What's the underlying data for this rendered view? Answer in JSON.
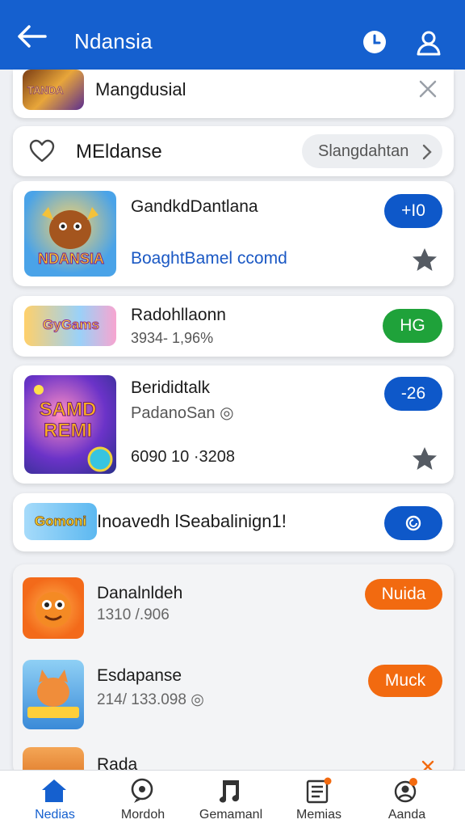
{
  "app": {
    "title": "Ndansia"
  },
  "top_row": {
    "title": "Mangdusial"
  },
  "search_row": {
    "label": "MEldanse",
    "button_label": "Slangdahtan"
  },
  "items": [
    {
      "title": "GandkdDantlana",
      "thumb_text": "NDANSIA",
      "subtitle": "BoaghtBamel ccomd",
      "badge": "+I0"
    },
    {
      "title": "Radohllaonn",
      "thumb_text": "GyGams",
      "meta": "3934- 1,96%",
      "badge": "HG"
    },
    {
      "title": "Berididtalk",
      "thumb_text": "SAMD REMI",
      "meta": "PadanoSan ◎",
      "stat": "6090 10 ·3208",
      "badge": "-26"
    }
  ],
  "promo": {
    "thumb_text": "Gomoni",
    "text": "Inoavedh lSeabalinign1!"
  },
  "list": [
    {
      "title": "Danalnldeh",
      "meta": "1310 /.906",
      "badge": "Nuida"
    },
    {
      "title": "Esdapanse",
      "meta": "214/ 133.098 ◎",
      "badge": "Muck"
    },
    {
      "title": "Rada"
    }
  ],
  "tabs": [
    {
      "label": "Nedias",
      "icon": "home-icon"
    },
    {
      "label": "Mordoh",
      "icon": "chat-icon"
    },
    {
      "label": "Gemamanl",
      "icon": "music-note-icon"
    },
    {
      "label": "Memias",
      "icon": "news-icon"
    },
    {
      "label": "Aanda",
      "icon": "profile-icon"
    }
  ],
  "colors": {
    "primary": "#1560cf",
    "green": "#1fa23a",
    "orange": "#f26a10"
  }
}
